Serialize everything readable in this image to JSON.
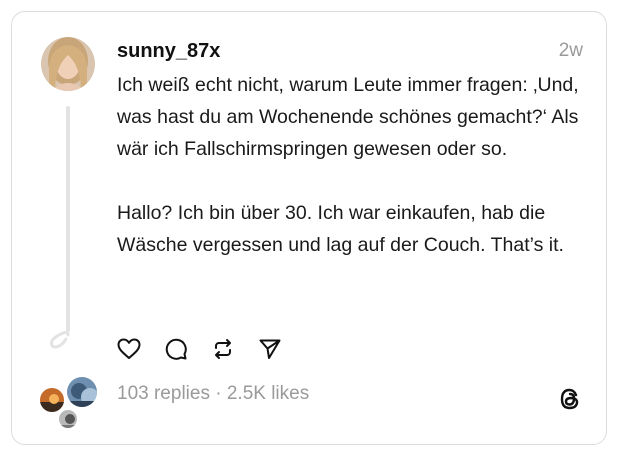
{
  "post": {
    "username": "sunny_87x",
    "time": "2w",
    "text": "Ich weiß echt nicht, warum Leute immer fragen: ‚Und, was hast du am Wochenende schönes gemacht?‘ Als wär ich Fallschirmspringen gewesen oder so.\n\nHallo? Ich bin über 30. Ich war einkaufen, hab die Wäsche vergessen und lag auf der Couch. That’s it."
  },
  "actions": {
    "icons": [
      "heart-icon",
      "comment-icon",
      "repost-icon",
      "share-icon"
    ]
  },
  "stats": {
    "replies": "103 replies",
    "separator": " · ",
    "likes": "2.5K likes"
  },
  "logo": "threads-logo",
  "colors": {
    "border": "#dcdcdc",
    "muted": "#9a9a9a",
    "text": "#1a1a1a"
  }
}
